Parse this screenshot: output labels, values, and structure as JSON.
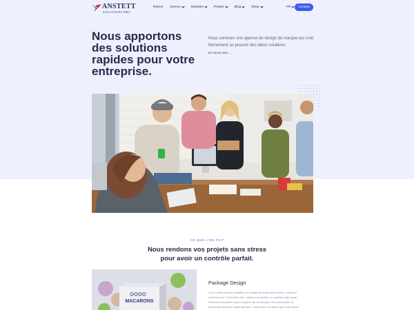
{
  "brand": {
    "name": "ANSTETT",
    "tagline": "SOLUTIONS PRO"
  },
  "nav": {
    "items": [
      {
        "label": "Retour",
        "has_dropdown": false
      },
      {
        "label": "Demos",
        "has_dropdown": true
      },
      {
        "label": "Modules",
        "has_dropdown": true
      },
      {
        "label": "Projets",
        "has_dropdown": true
      },
      {
        "label": "Blog",
        "has_dropdown": true
      },
      {
        "label": "Shop",
        "has_dropdown": true
      }
    ],
    "language": "FR",
    "contact_label": "Contact"
  },
  "hero": {
    "title": "Nous apportons des solutions rapides pour votre entreprise.",
    "subtitle": "Nous sommes une agence de design de marque qui croit fermement au pouvoir des idées créatives.",
    "link": "En savoir plus →"
  },
  "services": {
    "eyebrow": "CE QUE L'ON FAIT",
    "title_line1": "Nous rendons vos projets sans stress",
    "title_line2": "pour avoir un contrôle parfait.",
    "card": {
      "title": "Package Design",
      "image_text": "MACARONS",
      "text": "Cum sociis natoque penatibus et magnis dis parturient montes, nascetur ridiculus mus. Cras justo odio, dapibus ac facilisis in, egestas eget quam. Praesent commodo cursus magna, vel scelerisque nisl consectetur et. Maecenas faucibus mollis interdum. Maecenas sed diam eget risus varius."
    }
  },
  "colors": {
    "accent": "#3d5cf0",
    "hero_bg": "#eef1fd",
    "heading": "#252b49"
  }
}
